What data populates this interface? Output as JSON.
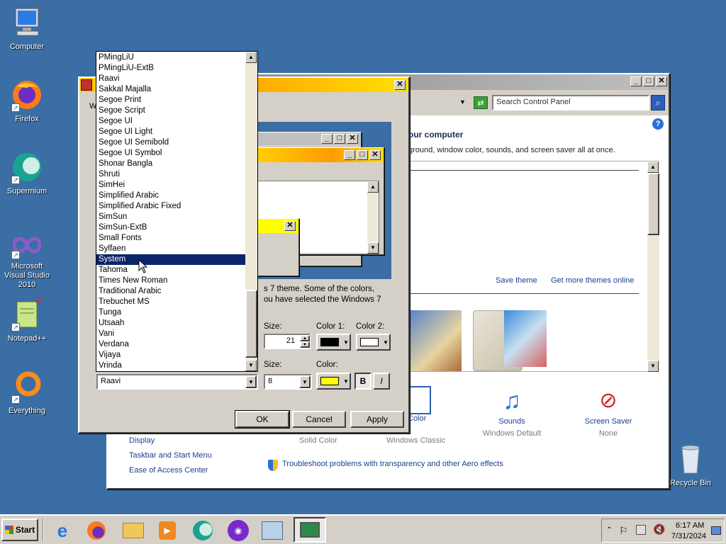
{
  "desktop": {
    "icons": [
      {
        "label": "Computer"
      },
      {
        "label": "Firefox"
      },
      {
        "label": "Supermium"
      },
      {
        "label": "Microsoft Visual Studio 2010"
      },
      {
        "label": "Notepad++"
      },
      {
        "label": "Everything"
      },
      {
        "label": "Recycle Bin"
      }
    ]
  },
  "control_panel": {
    "search_placeholder": "Search Control Panel",
    "heading": "our computer",
    "subheading": "ground, window color, sounds, and screen saver all at once.",
    "save_theme": "Save theme",
    "get_more_themes": "Get more themes online",
    "bottom_items": [
      {
        "label": "w Color",
        "value": "Solid Color"
      },
      {
        "label": "",
        "value": "Windows Classic"
      },
      {
        "label": "Sounds",
        "value": "Windows Default"
      },
      {
        "label": "Screen Saver",
        "value": "None"
      }
    ],
    "see_also": [
      "Display",
      "Taskbar and Start Menu",
      "Ease of Access Center"
    ],
    "troubleshoot": "Troubleshoot problems with transparency and other Aero effects"
  },
  "advanced_dialog": {
    "tab_label": "W",
    "description_line1": "s 7 theme.  Some of the colors,",
    "description_line2": "ou have selected the Windows 7",
    "item": {
      "size_label": "Size:",
      "size_value": "21",
      "color1_label": "Color 1:",
      "color2_label": "Color 2:",
      "color1": "#000000",
      "color2": "#ffffff"
    },
    "font": {
      "selected_font": "Raavi",
      "size_label": "Size:",
      "size_value": "8",
      "color_label": "Color:",
      "color": "#ffff00",
      "bold_label": "B",
      "italic_label": "I"
    },
    "ok_label": "OK",
    "cancel_label": "Cancel",
    "apply_label": "Apply"
  },
  "font_list": {
    "items": [
      "PMingLiU",
      "PMingLiU-ExtB",
      "Raavi",
      "Sakkal Majalla",
      "Segoe Print",
      "Segoe Script",
      "Segoe UI",
      "Segoe UI Light",
      "Segoe UI Semibold",
      "Segoe UI Symbol",
      "Shonar Bangla",
      "Shruti",
      "SimHei",
      "Simplified Arabic",
      "Simplified Arabic Fixed",
      "SimSun",
      "SimSun-ExtB",
      "Small Fonts",
      "Sylfaen",
      "System",
      "Tahoma",
      "Times New Roman",
      "Traditional Arabic",
      "Trebuchet MS",
      "Tunga",
      "Utsaah",
      "Vani",
      "Verdana",
      "Vijaya",
      "Vrinda"
    ],
    "selected": "System"
  },
  "taskbar": {
    "start_label": "Start",
    "time": "6:17 AM",
    "date": "7/31/2024"
  },
  "colors": {
    "desktop": "#3a6ea5",
    "selection": "#0a246a",
    "title_gradient_start": "#ffd200",
    "link": "#1a3f8f"
  }
}
